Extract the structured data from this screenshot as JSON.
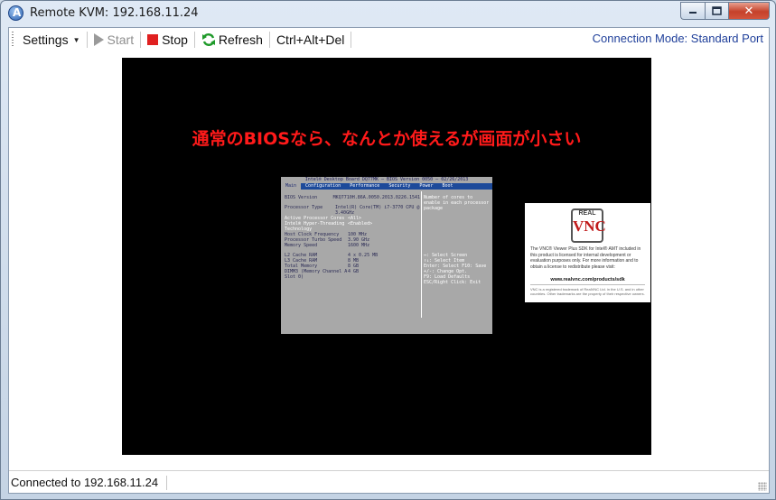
{
  "window": {
    "title": "Remote KVM: 192.168.11.24",
    "app_icon_glyph": "A",
    "controls": {
      "close_glyph": "✕"
    }
  },
  "toolbar": {
    "settings_label": "Settings",
    "start_label": "Start",
    "stop_label": "Stop",
    "refresh_label": "Refresh",
    "cad_label": "Ctrl+Alt+Del",
    "connection_mode": "Connection Mode: Standard Port"
  },
  "remote": {
    "overlay_caption": "通常のBIOSなら、なんとか使えるが画面が小さい",
    "bios": {
      "header": "Intel® Desktop Board DQ77MK — BIOS Version 0050 — 02/26/2013",
      "tabs": [
        "Main",
        "Configuration",
        "Performance",
        "Security",
        "Power",
        "Boot"
      ],
      "rows": [
        {
          "k": "BIOS Version",
          "v": "MKQ7710H.86A.0050.2013.0226.1541"
        },
        {
          "k": "",
          "v": ""
        },
        {
          "k": "Processor Type",
          "v": "Intel(R) Core(TM) i7-3770 CPU @ 3.40GHz"
        },
        {
          "k": "Active Processor Cores",
          "v": "<All>"
        },
        {
          "k": "Intel® Hyper-Threading Technology",
          "v": "<Enabled>"
        },
        {
          "k": "Host Clock Frequency",
          "v": "100 MHz"
        },
        {
          "k": "Processor Turbo Speed",
          "v": "3.90 GHz"
        },
        {
          "k": "Memory Speed",
          "v": "1600 MHz"
        },
        {
          "k": "",
          "v": ""
        },
        {
          "k": "L2 Cache RAM",
          "v": "4 x 0.25 MB"
        },
        {
          "k": "L3 Cache RAM",
          "v": "8 MB"
        },
        {
          "k": "Total Memory",
          "v": "8 GB"
        },
        {
          "k": "DIMM3 (Memory Channel A Slot 0)",
          "v": "4 GB"
        }
      ],
      "help_top": "Number of cores to enable in each processor package",
      "help_keys": [
        "↔: Select Screen",
        "↑↓: Select Item",
        "Enter: Select F10: Save",
        "+/-: Change Opt.",
        "F9: Load Defaults",
        "ESC/Right Click: Exit"
      ]
    },
    "vnc": {
      "logo_top": "REAL",
      "logo_main": "VNC",
      "notice": "The VNC® Viewer Plus SDK for Intel® AMT included in this product is licensed for internal development or evaluation purposes only. For more information and to obtain a license to redistribute please visit:",
      "url": "www.realvnc.com/products/sdk",
      "fine_print": "VNC is a registered trademark of RealVNC Ltd. in the U.S. and in other countries. Other trademarks are the property of their respective owners."
    }
  },
  "status": {
    "text": "Connected to 192.168.11.24"
  },
  "colors": {
    "overlay_text": "#ff1a1a",
    "connection_mode_text": "#1f3f9a",
    "bios_bg": "#a8a8a8",
    "bios_tab_bg": "#1d4a9a"
  }
}
